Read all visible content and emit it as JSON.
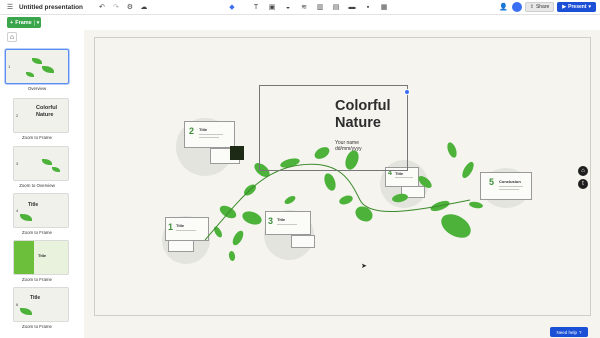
{
  "header": {
    "title": "Untitled presentation",
    "share_label": "Share",
    "present_label": "Present"
  },
  "toolbar": {
    "frame_label": "Frame"
  },
  "sidebar": {
    "slides": [
      {
        "num": "1",
        "label": "Overview"
      },
      {
        "num": "2",
        "label": "Zoom to Frame",
        "title": "Colorful Nature"
      },
      {
        "num": "3",
        "label": "Zoom to Overview"
      },
      {
        "num": "4",
        "label": "Zoom to Frame",
        "title": "Title"
      },
      {
        "num": "5",
        "label": "Zoom to Frame",
        "title": "Title"
      },
      {
        "num": "6",
        "label": "Zoom to Frame",
        "title": "Title"
      }
    ]
  },
  "canvas": {
    "main_title_line1": "Colorful",
    "main_title_line2": "Nature",
    "name_line": "Your name",
    "date_line": "dd/mm/yyyy",
    "topics": [
      {
        "num": "1",
        "title": "Title"
      },
      {
        "num": "2",
        "title": "Title"
      },
      {
        "num": "3",
        "title": "Title"
      },
      {
        "num": "4",
        "title": "Title"
      },
      {
        "num": "5",
        "title": "Conclusion"
      }
    ]
  },
  "help": {
    "label": "Need help"
  },
  "colors": {
    "accent_green": "#3aa54a",
    "present_blue": "#1a4fd6",
    "leaf_green": "#4cb23a"
  }
}
